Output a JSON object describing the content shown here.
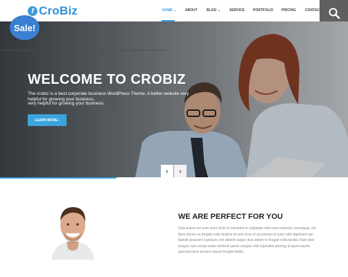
{
  "header": {
    "logo_text": "CroBiz",
    "logo_glyph": "f",
    "nav": [
      {
        "label": "HOME ⌄",
        "active": true
      },
      {
        "label": "ABOUT",
        "active": false
      },
      {
        "label": "BLOG ⌄",
        "active": false
      },
      {
        "label": "SERVICE",
        "active": false
      },
      {
        "label": "PORTFOLIO",
        "active": false
      },
      {
        "label": "PRICING",
        "active": false
      },
      {
        "label": "CONTACT",
        "active": false
      }
    ],
    "search_icon": "search-icon"
  },
  "sale_badge": "Sale!",
  "hero": {
    "title": "WELCOME TO CROBIZ",
    "description": "The crobiz is a best corporate business WordPress Theme. A better website very helpful for growing your business.",
    "description_repeat": "very helpful for growing your business.",
    "button_label": "LEARN MORE ›",
    "prev_label": "‹",
    "next_label": "›"
  },
  "about": {
    "title": "WE ARE PERFECT FOR YOU",
    "text": "Duis autem vel eum iriure dolor in hendrerit in vulputate velit esse molestie consequat, vel illum dolore eu feugiat nulla facilisis at vero eros et accumsan et iusto odio dignissim qui blandit praesent luptatum zzril delenit augue duis dolore te feugait nulla facilisi. Nam liber tempor cum soluta nobis eleifend option congue nihil imperdiet doming id quod mazim placerat facer possim assum feugiat facilis."
  },
  "colors": {
    "accent": "#3aa0e0",
    "logo": "#2f8fd8",
    "sale": "#3b7fd2"
  }
}
